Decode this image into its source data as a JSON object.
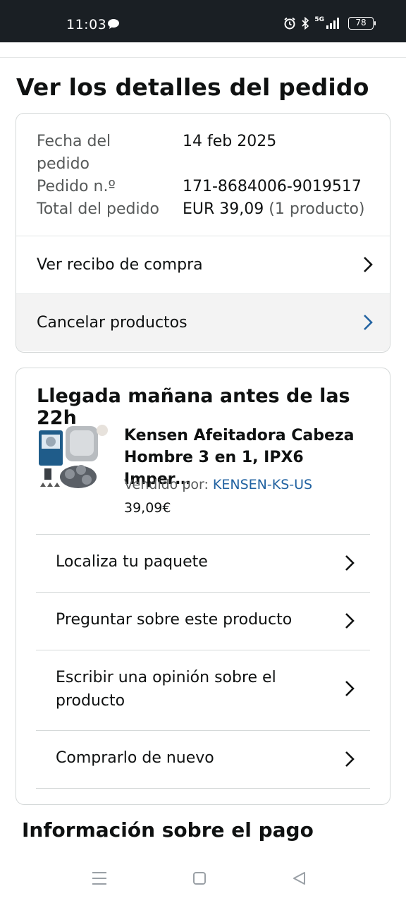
{
  "status_bar": {
    "time": "11:03",
    "network": "5G",
    "battery": "78"
  },
  "page": {
    "title": "Ver los detalles del pedido"
  },
  "order_info": {
    "date_label_line1": "Fecha del",
    "date_label_line2": "pedido",
    "date_value": "14 feb 2025",
    "number_label": "Pedido n.º",
    "number_value": "171-8684006-9019517",
    "total_label": "Total del pedido",
    "total_value": "EUR 39,09",
    "total_count": "(1 producto)"
  },
  "links": {
    "receipt": "Ver recibo de compra",
    "cancel": "Cancelar productos"
  },
  "shipment": {
    "arrival": "Llegada mañana antes de las 22h",
    "product_title_line1": "Kensen Afeitadora Cabeza",
    "product_title_line2": "Hombre 3 en 1, IPX6 Imper…",
    "seller_label": "Vendido por: ",
    "seller_name": "KENSEN-KS-US",
    "price": "39,09€",
    "actions": {
      "track": "Localiza tu paquete",
      "ask": "Preguntar sobre este producto",
      "review_line1": "Escribir una opinión sobre el",
      "review_line2": "producto",
      "buy_again": "Comprarlo de nuevo"
    }
  },
  "payment": {
    "title": "Información sobre el pago"
  },
  "colors": {
    "link_blue": "#2162a1",
    "status_bar_bg": "#1a1f24",
    "chevron_blue": "#2162a1"
  }
}
